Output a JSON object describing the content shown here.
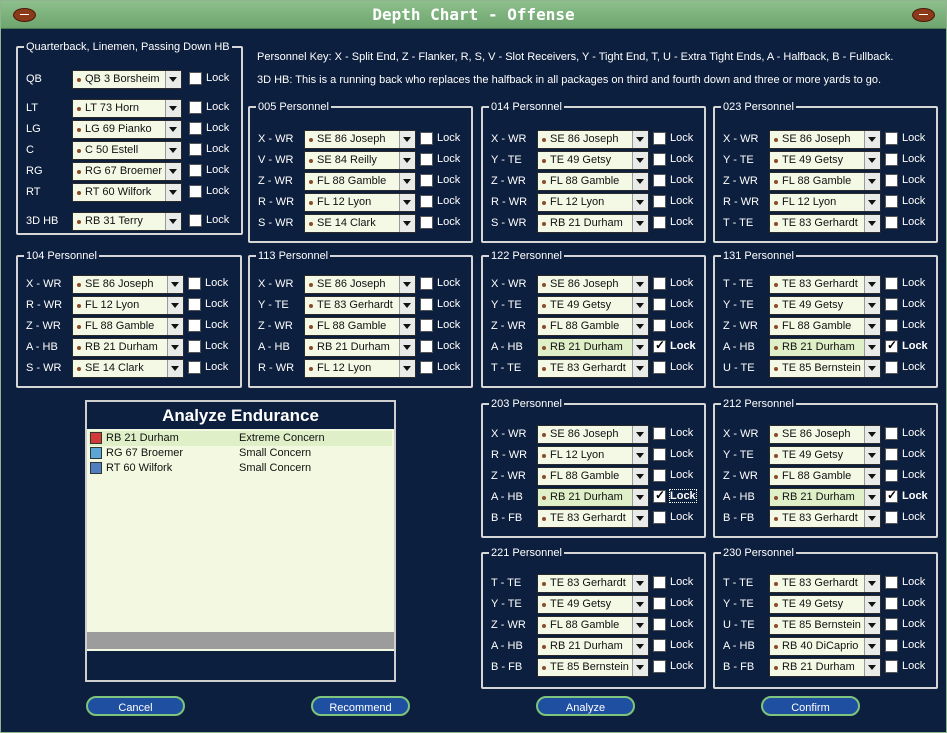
{
  "window": {
    "title": "Depth Chart - Offense"
  },
  "key": {
    "line1": "Personnel Key: X - Split End, Z - Flanker, R, S, V - Slot Receivers, Y - Tight End, T, U - Extra Tight Ends, A - Halfback, B - Fullback.",
    "line2": "3D HB: This is a running back who replaces the halfback in all packages on third and fourth down and three or more yards to go."
  },
  "lock_label": "Lock",
  "qb_group": {
    "title": "Quarterback, Linemen, Passing Down HB",
    "rows": [
      {
        "pos": "QB",
        "player": "QB 3 Borsheim",
        "locked": false
      },
      {
        "pos": "LT",
        "player": "LT 73 Horn",
        "locked": false
      },
      {
        "pos": "LG",
        "player": "LG 69 Pianko",
        "locked": false
      },
      {
        "pos": "C",
        "player": "C 50 Estell",
        "locked": false
      },
      {
        "pos": "RG",
        "player": "RG 67 Broemer",
        "locked": false
      },
      {
        "pos": "RT",
        "player": "RT 60 Wilfork",
        "locked": false
      },
      {
        "pos": "3D HB",
        "player": "RB 31 Terry",
        "locked": false
      }
    ]
  },
  "packages": [
    {
      "title": "005 Personnel",
      "rows": [
        {
          "pos": "X - WR",
          "player": "SE 86 Joseph",
          "locked": false
        },
        {
          "pos": "V - WR",
          "player": "SE 84 Reilly",
          "locked": false
        },
        {
          "pos": "Z - WR",
          "player": "FL 88 Gamble",
          "locked": false
        },
        {
          "pos": "R - WR",
          "player": "FL 12 Lyon",
          "locked": false
        },
        {
          "pos": "S - WR",
          "player": "SE 14 Clark",
          "locked": false
        }
      ]
    },
    {
      "title": "014 Personnel",
      "rows": [
        {
          "pos": "X - WR",
          "player": "SE 86 Joseph",
          "locked": false
        },
        {
          "pos": "Y - TE",
          "player": "TE 49 Getsy",
          "locked": false
        },
        {
          "pos": "Z - WR",
          "player": "FL 88 Gamble",
          "locked": false
        },
        {
          "pos": "R - WR",
          "player": "FL 12 Lyon",
          "locked": false
        },
        {
          "pos": "S - WR",
          "player": "RB 21 Durham",
          "locked": false
        }
      ]
    },
    {
      "title": "023 Personnel",
      "rows": [
        {
          "pos": "X - WR",
          "player": "SE 86 Joseph",
          "locked": false
        },
        {
          "pos": "Y - TE",
          "player": "TE 49 Getsy",
          "locked": false
        },
        {
          "pos": "Z - WR",
          "player": "FL 88 Gamble",
          "locked": false
        },
        {
          "pos": "R - WR",
          "player": "FL 12 Lyon",
          "locked": false
        },
        {
          "pos": "T - TE",
          "player": "TE 83 Gerhardt",
          "locked": false
        }
      ]
    },
    {
      "title": "104 Personnel",
      "rows": [
        {
          "pos": "X - WR",
          "player": "SE 86 Joseph",
          "locked": false
        },
        {
          "pos": "R - WR",
          "player": "FL 12 Lyon",
          "locked": false
        },
        {
          "pos": "Z - WR",
          "player": "FL 88 Gamble",
          "locked": false
        },
        {
          "pos": "A - HB",
          "player": "RB 21 Durham",
          "locked": false
        },
        {
          "pos": "S - WR",
          "player": "SE 14 Clark",
          "locked": false
        }
      ]
    },
    {
      "title": "113 Personnel",
      "rows": [
        {
          "pos": "X - WR",
          "player": "SE 86 Joseph",
          "locked": false
        },
        {
          "pos": "Y - TE",
          "player": "TE 83 Gerhardt",
          "locked": false
        },
        {
          "pos": "Z - WR",
          "player": "FL 88 Gamble",
          "locked": false
        },
        {
          "pos": "A - HB",
          "player": "RB 21 Durham",
          "locked": false
        },
        {
          "pos": "R - WR",
          "player": "FL 12 Lyon",
          "locked": false
        }
      ]
    },
    {
      "title": "122 Personnel",
      "rows": [
        {
          "pos": "X - WR",
          "player": "SE 86 Joseph",
          "locked": false
        },
        {
          "pos": "Y - TE",
          "player": "TE 49 Getsy",
          "locked": false
        },
        {
          "pos": "Z - WR",
          "player": "FL 88 Gamble",
          "locked": false
        },
        {
          "pos": "A - HB",
          "player": "RB 21 Durham",
          "locked": true
        },
        {
          "pos": "T - TE",
          "player": "TE 83 Gerhardt",
          "locked": false
        }
      ]
    },
    {
      "title": "131 Personnel",
      "rows": [
        {
          "pos": "T - TE",
          "player": "TE 83 Gerhardt",
          "locked": false
        },
        {
          "pos": "Y - TE",
          "player": "TE 49 Getsy",
          "locked": false
        },
        {
          "pos": "Z - WR",
          "player": "FL 88 Gamble",
          "locked": false
        },
        {
          "pos": "A - HB",
          "player": "RB 21 Durham",
          "locked": true
        },
        {
          "pos": "U - TE",
          "player": "TE 85 Bernstein",
          "locked": false
        }
      ]
    },
    {
      "title": "203 Personnel",
      "rows": [
        {
          "pos": "X - WR",
          "player": "SE 86 Joseph",
          "locked": false
        },
        {
          "pos": "R - WR",
          "player": "FL 12 Lyon",
          "locked": false
        },
        {
          "pos": "Z - WR",
          "player": "FL 88 Gamble",
          "locked": false
        },
        {
          "pos": "A - HB",
          "player": "RB 21 Durham",
          "locked": true
        },
        {
          "pos": "B - FB",
          "player": "TE 83 Gerhardt",
          "locked": false
        }
      ]
    },
    {
      "title": "212 Personnel",
      "rows": [
        {
          "pos": "X - WR",
          "player": "SE 86 Joseph",
          "locked": false
        },
        {
          "pos": "Y - TE",
          "player": "TE 49 Getsy",
          "locked": false
        },
        {
          "pos": "Z - WR",
          "player": "FL 88 Gamble",
          "locked": false
        },
        {
          "pos": "A - HB",
          "player": "RB 21 Durham",
          "locked": true
        },
        {
          "pos": "B - FB",
          "player": "TE 83 Gerhardt",
          "locked": false
        }
      ]
    },
    {
      "title": "221 Personnel",
      "rows": [
        {
          "pos": "T - TE",
          "player": "TE 83 Gerhardt",
          "locked": false
        },
        {
          "pos": "Y - TE",
          "player": "TE 49 Getsy",
          "locked": false
        },
        {
          "pos": "Z - WR",
          "player": "FL 88 Gamble",
          "locked": false
        },
        {
          "pos": "A - HB",
          "player": "RB 21 Durham",
          "locked": false
        },
        {
          "pos": "B - FB",
          "player": "TE 85 Bernstein",
          "locked": false
        }
      ]
    },
    {
      "title": "230 Personnel",
      "rows": [
        {
          "pos": "T - TE",
          "player": "TE 83 Gerhardt",
          "locked": false
        },
        {
          "pos": "Y - TE",
          "player": "TE 49 Getsy",
          "locked": false
        },
        {
          "pos": "U - TE",
          "player": "TE 85 Bernstein",
          "locked": false
        },
        {
          "pos": "A - HB",
          "player": "RB 40 DiCaprio",
          "locked": false
        },
        {
          "pos": "B - FB",
          "player": "RB 21 Durham",
          "locked": false
        }
      ]
    }
  ],
  "endurance": {
    "title": "Analyze Endurance",
    "rows": [
      {
        "player": "RB 21 Durham",
        "status": "Extreme Concern",
        "color": "#d23a3a"
      },
      {
        "player": "RG 67 Broemer",
        "status": "Small Concern",
        "color": "#5aa6d6"
      },
      {
        "player": "RT 60 Wilfork",
        "status": "Small Concern",
        "color": "#4f7fc0"
      }
    ]
  },
  "buttons": {
    "cancel": "Cancel",
    "recommend": "Recommend",
    "analyze": "Analyze",
    "confirm": "Confirm"
  }
}
